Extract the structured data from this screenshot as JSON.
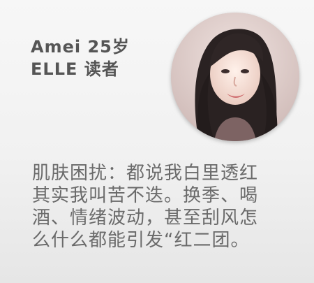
{
  "reader": {
    "name": "Amei 25岁",
    "role": "ELLE 读者"
  },
  "quote": {
    "lines": [
      "肌肤困扰：都说我白里透红",
      "其实我叫苦不迭。换季、喝",
      "酒、情绪波动，甚至刮风怎",
      "么什么都能引发“红二团。"
    ]
  },
  "colors": {
    "text": "#555555",
    "quote_text": "#6a6a6a",
    "background": "#f1f1f1"
  }
}
